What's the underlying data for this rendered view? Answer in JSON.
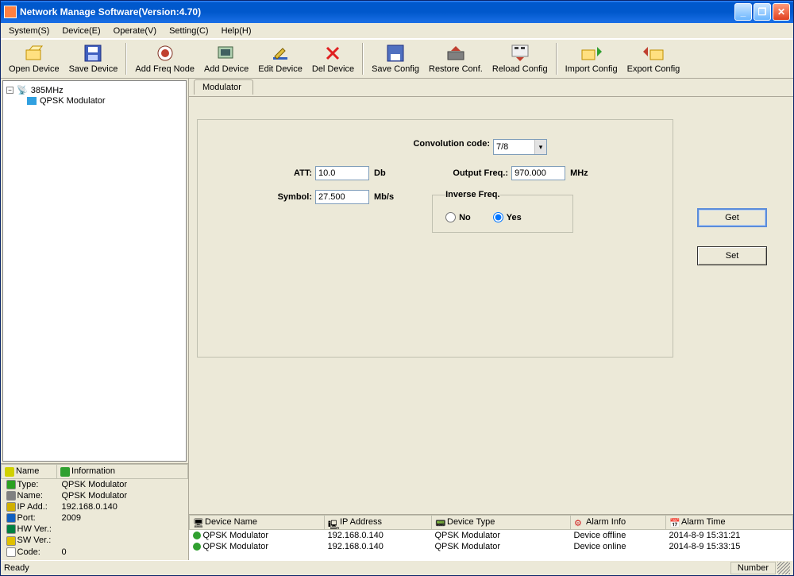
{
  "window": {
    "title": "Network Manage Software(Version:4.70)"
  },
  "menu": [
    "System(S)",
    "Device(E)",
    "Operate(V)",
    "Setting(C)",
    "Help(H)"
  ],
  "toolbar": [
    {
      "label": "Open Device"
    },
    {
      "label": "Save Device"
    },
    {
      "label": "Add Freq Node"
    },
    {
      "label": "Add Device"
    },
    {
      "label": "Edit Device"
    },
    {
      "label": "Del Device"
    },
    {
      "label": "Save Config"
    },
    {
      "label": "Restore Conf."
    },
    {
      "label": "Reload Config"
    },
    {
      "label": "Import Config"
    },
    {
      "label": "Export Config"
    }
  ],
  "tree": {
    "root": "385MHz",
    "child": "QPSK Modulator"
  },
  "info": {
    "headers": [
      "Name",
      "Information"
    ],
    "rows": [
      {
        "k": "Type:",
        "v": "QPSK Modulator",
        "c": "#2aa020"
      },
      {
        "k": "Name:",
        "v": "QPSK Modulator",
        "c": "#808080"
      },
      {
        "k": "IP Add.:",
        "v": "192.168.0.140",
        "c": "#d0b000"
      },
      {
        "k": "Port:",
        "v": "2009",
        "c": "#1060c0"
      },
      {
        "k": "HW Ver.:",
        "v": "",
        "c": "#008040"
      },
      {
        "k": "SW Ver.:",
        "v": "",
        "c": "#e0c000"
      },
      {
        "k": "Code:",
        "v": "0",
        "c": "#ffffff"
      }
    ]
  },
  "tab": {
    "label": "Modulator"
  },
  "form": {
    "conv_label": "Convolution code:",
    "conv_value": "7/8",
    "att_label": "ATT:",
    "att_value": "10.0",
    "att_unit": "Db",
    "outf_label": "Output Freq.:",
    "outf_value": "970.000",
    "outf_unit": "MHz",
    "sym_label": "Symbol:",
    "sym_value": "27.500",
    "sym_unit": "Mb/s",
    "inv_legend": "Inverse Freq.",
    "inv_no": "No",
    "inv_yes": "Yes",
    "btn_get": "Get",
    "btn_set": "Set"
  },
  "devtable": {
    "headers": [
      "Device Name",
      "IP Address",
      "Device Type",
      "Alarm Info",
      "Alarm Time"
    ],
    "rows": [
      {
        "name": "QPSK Modulator",
        "ip": "192.168.0.140",
        "type": "QPSK Modulator",
        "alarm": "Device offline",
        "time": "2014-8-9 15:31:21"
      },
      {
        "name": "QPSK Modulator",
        "ip": "192.168.0.140",
        "type": "QPSK Modulator",
        "alarm": "Device online",
        "time": "2014-8-9 15:33:15"
      }
    ]
  },
  "status": {
    "left": "Ready",
    "right": "Number"
  }
}
